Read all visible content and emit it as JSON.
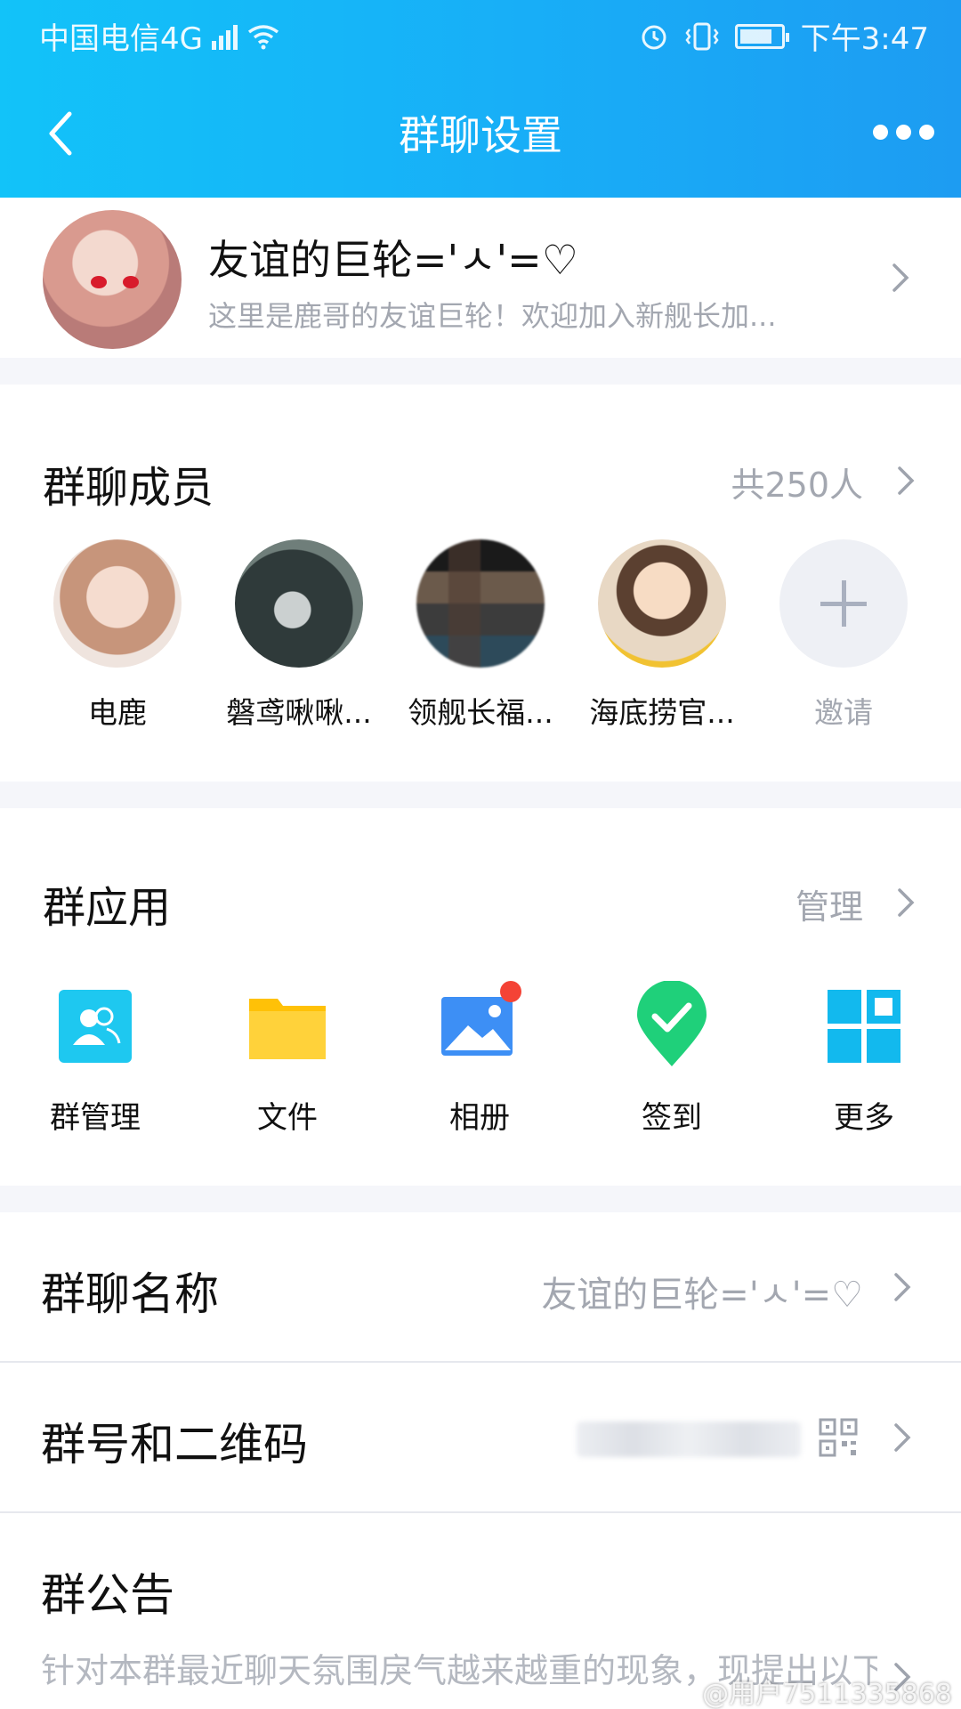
{
  "status_bar": {
    "carrier": "中国电信4G",
    "network_badge": "4G",
    "time": "下午3:47",
    "icons": [
      "signal-icon",
      "wifi-icon",
      "alarm-icon",
      "vibrate-icon",
      "battery-icon"
    ]
  },
  "header": {
    "title": "群聊设置",
    "back_icon": "back-chevron-icon",
    "more_icon": "more-dots-icon"
  },
  "group": {
    "name": "友谊的巨轮='ㅅ'=♡",
    "description": "这里是鹿哥的友谊巨轮！欢迎加入新舰长加..."
  },
  "members_section": {
    "title": "群聊成员",
    "count": "共250人",
    "members": [
      {
        "name": "电鹿"
      },
      {
        "name": "磐鸢啾啾..."
      },
      {
        "name": "领舰长福..."
      },
      {
        "name": "海底捞官..."
      }
    ],
    "invite_label": "邀请"
  },
  "apps_section": {
    "title": "群应用",
    "manage_label": "管理",
    "apps": [
      {
        "label": "群管理",
        "icon": "group-manage-icon",
        "color": "#1ec8f0"
      },
      {
        "label": "文件",
        "icon": "folder-icon",
        "color": "#ffc107"
      },
      {
        "label": "相册",
        "icon": "album-icon",
        "color": "#3d8ff5"
      },
      {
        "label": "签到",
        "icon": "checkin-icon",
        "color": "#1fd07a"
      },
      {
        "label": "更多",
        "icon": "grid-more-icon",
        "color": "#12b9ee"
      }
    ]
  },
  "settings": {
    "group_name_label": "群聊名称",
    "group_name_value": "友谊的巨轮='ㅅ'=♡",
    "group_id_label": "群号和二维码",
    "notice_label": "群公告",
    "notice_text": "针对本群最近聊天氛围戾气越来越重的现象，现提出以下要求"
  },
  "watermark": "@用户7511335868"
}
